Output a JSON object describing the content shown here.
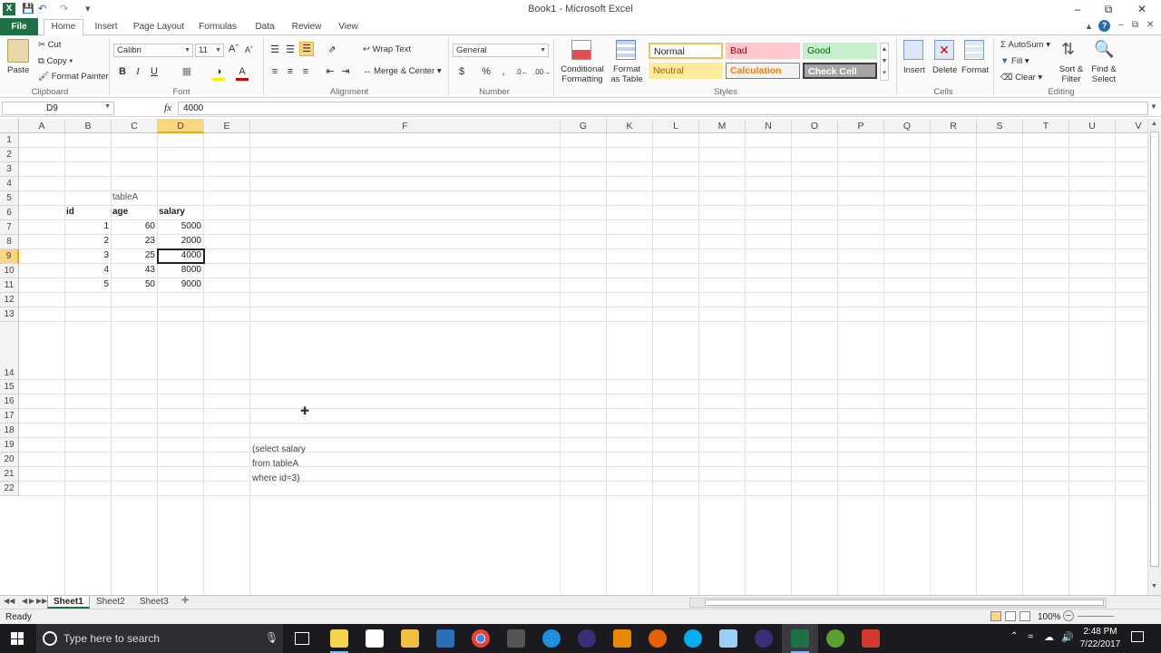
{
  "window": {
    "title": "Book1 - Microsoft Excel"
  },
  "tabs": [
    "File",
    "Home",
    "Insert",
    "Page Layout",
    "Formulas",
    "Data",
    "Review",
    "View"
  ],
  "ribbon": {
    "clipboard": {
      "paste": "Paste",
      "cut": "Cut",
      "copy": "Copy",
      "format_painter": "Format Painter",
      "label": "Clipboard"
    },
    "font": {
      "name": "Calibri",
      "size": "11",
      "label": "Font",
      "bold": "B",
      "italic": "I",
      "underline": "U"
    },
    "alignment": {
      "wrap": "Wrap Text",
      "merge": "Merge & Center",
      "label": "Alignment"
    },
    "number": {
      "format": "General",
      "label": "Number",
      "currency": "$",
      "percent": "%",
      "comma": ","
    },
    "styles": {
      "conditional": "Conditional Formatting",
      "format_table": "Format as Table",
      "normal": "Normal",
      "bad": "Bad",
      "good": "Good",
      "neutral": "Neutral",
      "calculation": "Calculation",
      "check_cell": "Check Cell",
      "label": "Styles"
    },
    "cells": {
      "insert": "Insert",
      "delete": "Delete",
      "format": "Format",
      "label": "Cells"
    },
    "editing": {
      "autosum": "AutoSum",
      "fill": "Fill",
      "clear": "Clear",
      "sort": "Sort & Filter",
      "find": "Find & Select",
      "label": "Editing"
    }
  },
  "formula_bar": {
    "name_box": "D9",
    "fx": "fx",
    "value": "4000"
  },
  "columns": [
    "A",
    "B",
    "C",
    "D",
    "E",
    "F",
    "G",
    "K",
    "L",
    "M",
    "N",
    "O",
    "P",
    "Q",
    "R",
    "S",
    "T",
    "U",
    "V"
  ],
  "rows": [
    "1",
    "2",
    "3",
    "4",
    "5",
    "6",
    "7",
    "8",
    "9",
    "10",
    "11",
    "12",
    "13",
    "14",
    "15",
    "16",
    "17",
    "18",
    "19",
    "20",
    "21",
    "22"
  ],
  "cells": {
    "c5": "tableA",
    "b6": "id",
    "c6": "age",
    "d6": "salary",
    "b7": "1",
    "c7": "60",
    "d7": "5000",
    "b8": "2",
    "c8": "23",
    "d8": "2000",
    "b9": "3",
    "c9": "25",
    "d9": "4000",
    "b10": "4",
    "c10": "43",
    "d10": "8000",
    "b11": "5",
    "c11": "50",
    "d11": "9000",
    "f14_line1": "(select salary",
    "f14_line2": "from tableA",
    "f14_line3": "where id=3)"
  },
  "sheets": [
    "Sheet1",
    "Sheet2",
    "Sheet3"
  ],
  "status": {
    "text": "Ready",
    "zoom": "100%"
  },
  "taskbar": {
    "search": "Type here to search",
    "time": "2:48 PM",
    "date": "7/22/2017"
  },
  "colors": {
    "excel_green": "#1e7145",
    "selected_header": "#f9d77e"
  }
}
